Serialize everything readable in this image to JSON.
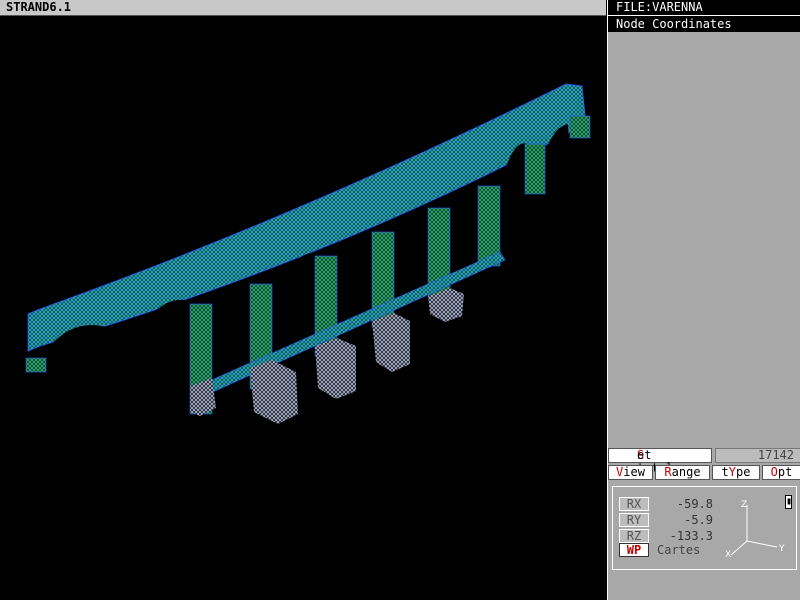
{
  "app": {
    "title": "STRAND6.1"
  },
  "panel": {
    "file_label": "FILE:VARENNA",
    "mode_label": "Node Coordinates",
    "set_total": {
      "hot": "S",
      "rest": "et total",
      "value": "17142"
    },
    "menu": [
      {
        "hot": "V",
        "rest": "iew",
        "pre": ""
      },
      {
        "hot": "R",
        "rest": "ange",
        "pre": ""
      },
      {
        "hot": "Y",
        "rest": "pe",
        "pre": "t"
      },
      {
        "hot": "O",
        "rest": "pt",
        "pre": ""
      }
    ],
    "rotation": {
      "rx_label": "RX",
      "rx": "-59.8",
      "ry_label": "RY",
      "ry": "-5.9",
      "rz_label": "RZ",
      "rz": "-133.3"
    },
    "wp_label": "WP",
    "coord_system": "Cartes",
    "axis_labels": {
      "x": "X",
      "y": "Y",
      "z": "Z"
    }
  },
  "model": {
    "colors": {
      "mesh_primary": "#1fc7c7",
      "mesh_secondary": "#1a9a6a",
      "mesh_edge": "#2b5cff",
      "background": "#000000"
    }
  }
}
